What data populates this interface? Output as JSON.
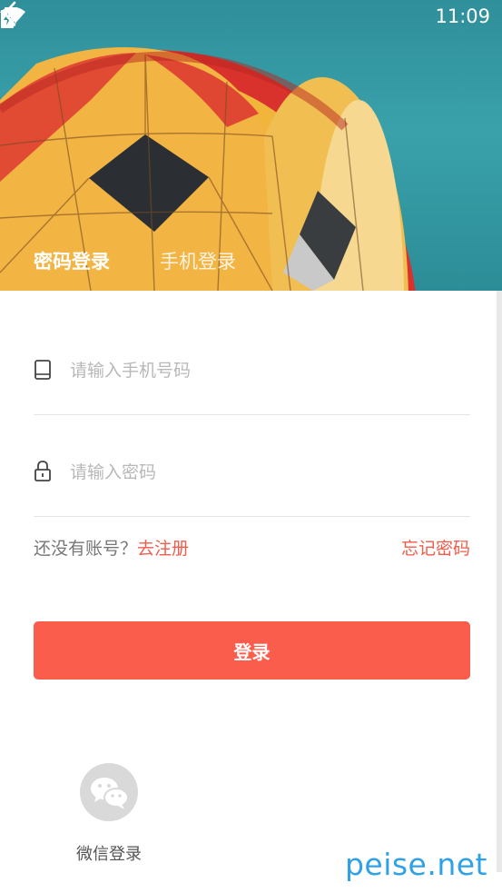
{
  "status_bar": {
    "time": "11:09",
    "wifi_icon": "wifi-icon",
    "sim_icon": "no-sim-icon",
    "battery_icon": "battery-charging-icon"
  },
  "header": {
    "back_icon": "back-chevron-icon",
    "tabs": [
      {
        "label": "密码登录",
        "active": true
      },
      {
        "label": "手机登录",
        "active": false
      }
    ]
  },
  "form": {
    "phone": {
      "icon": "phone-icon",
      "placeholder": "请输入手机号码",
      "value": ""
    },
    "password": {
      "icon": "lock-icon",
      "placeholder": "请输入密码",
      "value": ""
    }
  },
  "links": {
    "no_account": "还没有账号？",
    "register": "去注册",
    "forgot": "忘记密码"
  },
  "login_button": "登录",
  "social": {
    "wechat_label": "微信登录",
    "icon": "wechat-icon"
  },
  "watermark": "peise.net",
  "colors": {
    "accent": "#fb5d4c",
    "link": "#f25b4a",
    "watermark": "#2fa1e6"
  }
}
